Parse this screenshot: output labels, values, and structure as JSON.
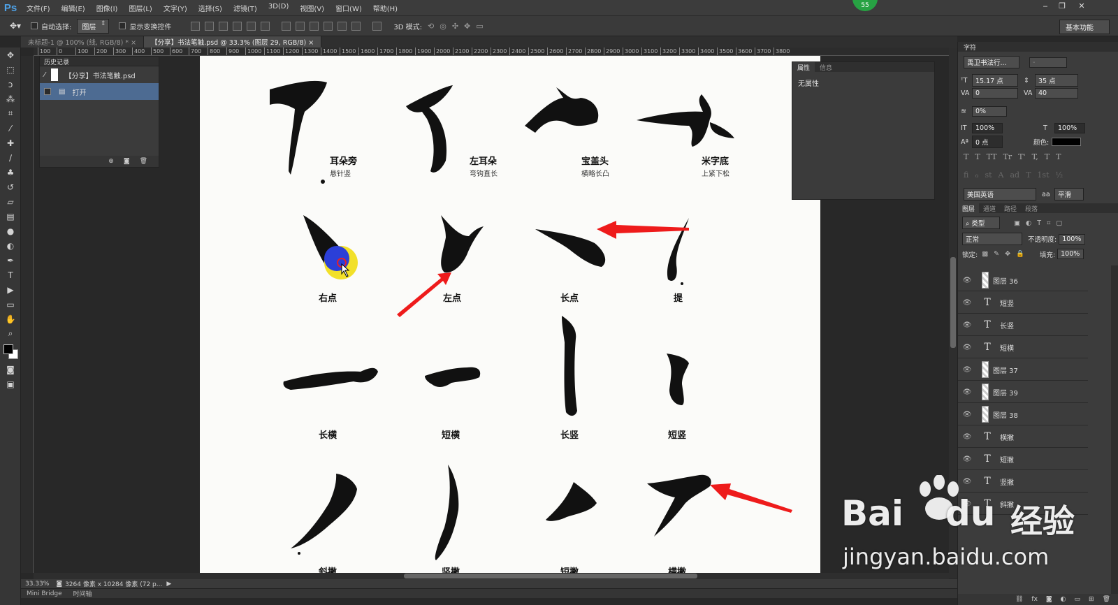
{
  "app": {
    "logo": "Ps"
  },
  "menu": [
    "文件(F)",
    "编辑(E)",
    "图像(I)",
    "图层(L)",
    "文字(Y)",
    "选择(S)",
    "滤镜(T)",
    "3D(D)",
    "视图(V)",
    "窗口(W)",
    "帮助(H)"
  ],
  "notification_badge": "55",
  "options": {
    "auto_select_label": "自动选择:",
    "auto_select_value": "图层",
    "show_transform_label": "显示变换控件",
    "mode3d_label": "3D 模式:",
    "workspace": "基本功能"
  },
  "doc_tabs": [
    "未标题-1 @ 100% (线, RGB/8) *",
    "【分享】书法笔触.psd @ 33.3% (图层 29, RGB/8)"
  ],
  "ruler_ticks": [
    "100",
    "0",
    "100",
    "200",
    "300",
    "400",
    "500",
    "600",
    "700",
    "800",
    "900",
    "1000",
    "1100",
    "1200",
    "1300",
    "1400",
    "1500",
    "1600",
    "1700",
    "1800",
    "1900",
    "2000",
    "2100",
    "2200",
    "2300",
    "2400",
    "2500",
    "2600",
    "2700",
    "2800",
    "2900",
    "3000",
    "3100",
    "3200",
    "3300",
    "3400",
    "3500",
    "3600",
    "3700",
    "3800"
  ],
  "history": {
    "tab": "历史记录",
    "snapshot": "【分享】书法笔触.psd",
    "items": [
      "打开"
    ]
  },
  "properties": {
    "tabs": [
      "属性",
      "信息"
    ],
    "content": "无属性"
  },
  "character": {
    "tab": "字符",
    "font": "禹卫书法行...",
    "style": "-",
    "size": "15.17 点",
    "leading": "35 点",
    "kerning": "0",
    "tracking": "40",
    "scale_pct": "0%",
    "vscale": "100%",
    "hscale": "100%",
    "baseline": "0 点",
    "color_label": "颜色:",
    "language": "美国英语",
    "aa_label": "aa",
    "antialias": "平滑",
    "typo_buttons": [
      "T",
      "T",
      "TT",
      "Tr",
      "T'",
      "T,",
      "T",
      "T"
    ]
  },
  "layers": {
    "tabs": [
      "图层",
      "通道",
      "路径",
      "段落"
    ],
    "filter": "类型",
    "blend_mode": "正常",
    "opacity_label": "不透明度:",
    "opacity": "100%",
    "lock_label": "锁定:",
    "fill_label": "填充:",
    "fill": "100%",
    "items": [
      {
        "name": "图层 36",
        "type": "pixel"
      },
      {
        "name": "短竖",
        "type": "text"
      },
      {
        "name": "长竖",
        "type": "text"
      },
      {
        "name": "短横",
        "type": "text"
      },
      {
        "name": "图层 37",
        "type": "pixel"
      },
      {
        "name": "图层 39",
        "type": "pixel"
      },
      {
        "name": "图层 38",
        "type": "pixel"
      },
      {
        "name": "横撇",
        "type": "text"
      },
      {
        "name": "短撇",
        "type": "text"
      },
      {
        "name": "竖撇",
        "type": "text"
      },
      {
        "name": "斜撇",
        "type": "text"
      }
    ]
  },
  "artwork": {
    "row1": [
      {
        "name": "耳朵旁",
        "sub": "悬针竖"
      },
      {
        "name": "左耳朵",
        "sub": "弯钩直长"
      },
      {
        "name": "宝盖头",
        "sub": "横略长凸"
      },
      {
        "name": "米字底",
        "sub": "上紧下松"
      }
    ],
    "row2": [
      "右点",
      "左点",
      "长点",
      "提"
    ],
    "row3": [
      "长横",
      "短横",
      "长竖",
      "短竖"
    ],
    "row4": [
      "斜撇",
      "竖撇",
      "短撇",
      "横撇"
    ]
  },
  "status": {
    "zoom": "33.33%",
    "doc_info": "3264 像素 x 10284 像素 (72 p..."
  },
  "bottom_tabs": [
    "Mini Bridge",
    "时间轴"
  ],
  "watermark": {
    "brand": "Bai",
    "brand2": "du",
    "cn": "经验",
    "url": "jingyan.baidu.com"
  }
}
